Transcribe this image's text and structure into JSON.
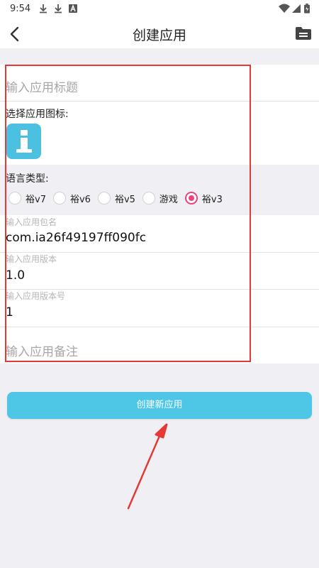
{
  "status_bar": {
    "time": "9:54"
  },
  "header": {
    "title": "创建应用"
  },
  "form": {
    "title_placeholder": "输入应用标题",
    "icon_label": "选择应用图标:",
    "language_label": "语言类型:",
    "language_options": [
      {
        "label": "裕v7",
        "selected": false
      },
      {
        "label": "裕v6",
        "selected": false
      },
      {
        "label": "裕v5",
        "selected": false
      },
      {
        "label": "游戏",
        "selected": false
      },
      {
        "label": "裕v3",
        "selected": true
      }
    ],
    "package_label": "输入应用包名",
    "package_value": "com.ia26f49197ff090fc",
    "version_label": "输入应用版本",
    "version_value": "1.0",
    "version_code_label": "输入应用版本号",
    "version_code_value": "1",
    "remark_placeholder": "输入应用备注"
  },
  "create_button": {
    "label": "创建新应用"
  },
  "colors": {
    "accent": "#4ec7e7",
    "radio_selected": "#e5457c",
    "annotation": "#e53935"
  }
}
